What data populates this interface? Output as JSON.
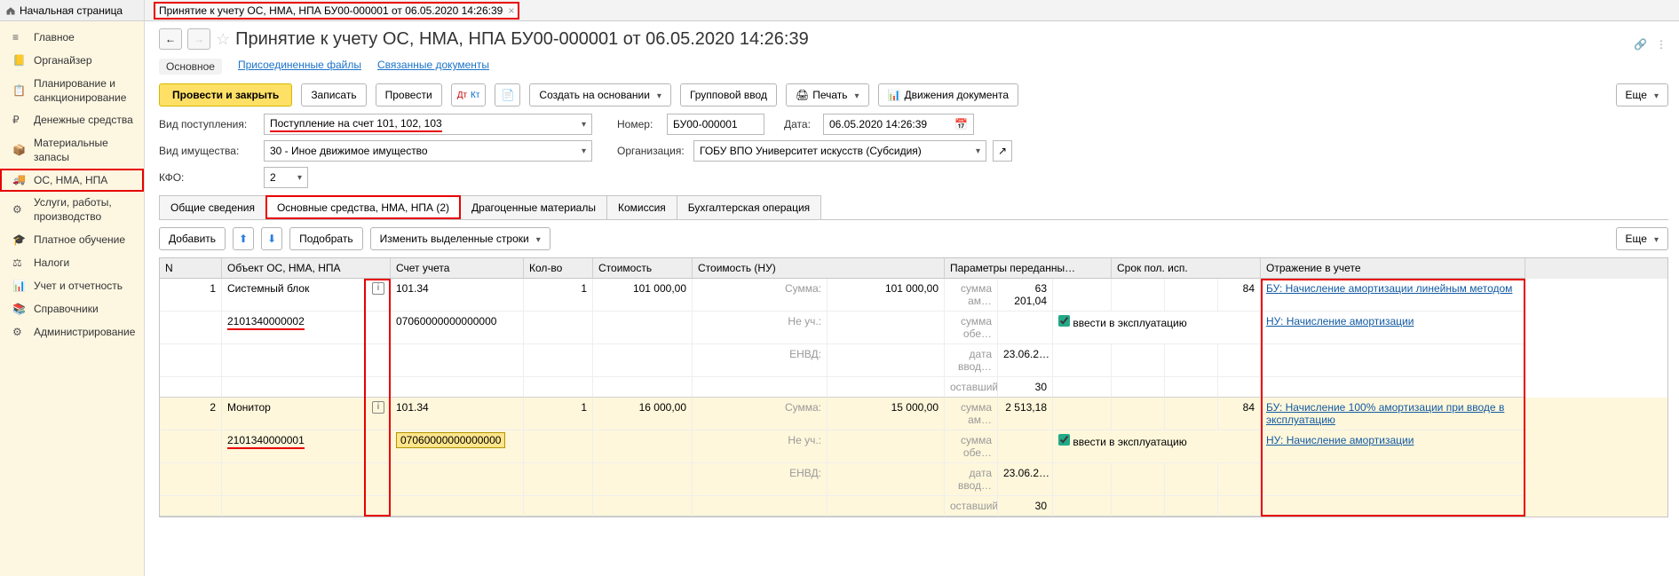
{
  "home_tab": "Начальная страница",
  "top_tab": "Принятие к учету ОС, НМА, НПА БУ00-000001 от 06.05.2020 14:26:39",
  "sidebar": {
    "items": [
      {
        "label": "Главное"
      },
      {
        "label": "Органайзер"
      },
      {
        "label": "Планирование и санкционирование"
      },
      {
        "label": "Денежные средства"
      },
      {
        "label": "Материальные запасы"
      },
      {
        "label": "ОС, НМА, НПА"
      },
      {
        "label": "Услуги, работы, производство"
      },
      {
        "label": "Платное обучение"
      },
      {
        "label": "Налоги"
      },
      {
        "label": "Учет и отчетность"
      },
      {
        "label": "Справочники"
      },
      {
        "label": "Администрирование"
      }
    ],
    "active_index": 5
  },
  "title": "Принятие к учету ОС, НМА, НПА БУ00-000001 от 06.05.2020 14:26:39",
  "subnav": {
    "main": "Основное",
    "files": "Присоединенные файлы",
    "linked": "Связанные документы"
  },
  "toolbar": {
    "post_close": "Провести и закрыть",
    "save": "Записать",
    "post": "Провести",
    "create_based": "Создать на основании",
    "group": "Групповой ввод",
    "print": "Печать",
    "moves": "Движения документа",
    "more": "Еще"
  },
  "form": {
    "receipt_lbl": "Вид поступления:",
    "receipt_val": "Поступление на счет 101, 102, 103",
    "num_lbl": "Номер:",
    "num_val": "БУ00-000001",
    "date_lbl": "Дата:",
    "date_val": "06.05.2020 14:26:39",
    "asset_type_lbl": "Вид имущества:",
    "asset_type_val": "30 - Иное движимое имущество",
    "org_lbl": "Организация:",
    "org_val": "ГОБУ ВПО Университет искусств (Субсидия)",
    "kfo_lbl": "КФО:",
    "kfo_val": "2"
  },
  "tabs2": {
    "t1": "Общие сведения",
    "t2": "Основные средства, НМА, НПА (2)",
    "t3": "Драгоценные материалы",
    "t4": "Комиссия",
    "t5": "Бухгалтерская операция"
  },
  "subtb": {
    "add": "Добавить",
    "pick": "Подобрать",
    "edit": "Изменить выделенные строки",
    "more": "Еще"
  },
  "thead": {
    "n": "N",
    "obj": "Объект ОС, НМА, НПА",
    "acct": "Счет учета",
    "qty": "Кол-во",
    "cost": "Стоимость",
    "cost_nu": "Стоимость (НУ)",
    "params": "Параметры переданны…",
    "srok": "Срок пол. исп.",
    "refl": "Отражение в учете"
  },
  "rows": [
    {
      "n": "1",
      "obj_name": "Системный блок",
      "obj_inv": "2101340000002",
      "acct": "101.34",
      "acct2": "07060000000000000",
      "qty": "1",
      "cost": "101 000,00",
      "nu1_lbl": "Сумма:",
      "nu1_val": "101 000,00",
      "nu2_lbl": "Не уч.:",
      "nu3_lbl": "ЕНВД:",
      "p1_lbl": "сумма ам…",
      "p1_val": "63 201,04",
      "p2_lbl": "сумма обе…",
      "p3_lbl": "дата ввод…",
      "p3_val": "23.06.2…",
      "p4_lbl": "оставшийс…",
      "p4_val": "30",
      "srok": "84",
      "chk": true,
      "chk_lbl": "ввести в эксплуатацию",
      "ref1": "БУ: Начисление амортизации линейным методом",
      "ref2": "НУ: Начисление амортизации"
    },
    {
      "n": "2",
      "obj_name": "Монитор",
      "obj_inv": "2101340000001",
      "acct": "101.34",
      "acct2": "07060000000000000",
      "qty": "1",
      "cost": "16 000,00",
      "nu1_lbl": "Сумма:",
      "nu1_val": "15 000,00",
      "nu2_lbl": "Не уч.:",
      "nu3_lbl": "ЕНВД:",
      "p1_lbl": "сумма ам…",
      "p1_val": "2 513,18",
      "p2_lbl": "сумма обе…",
      "p3_lbl": "дата ввод…",
      "p3_val": "23.06.2…",
      "p4_lbl": "оставшийс…",
      "p4_val": "30",
      "srok": "84",
      "chk": true,
      "chk_lbl": "ввести в эксплуатацию",
      "ref1": "БУ: Начисление 100% амортизации при вводе в эксплуатацию",
      "ref2": "НУ: Начисление амортизации"
    }
  ]
}
